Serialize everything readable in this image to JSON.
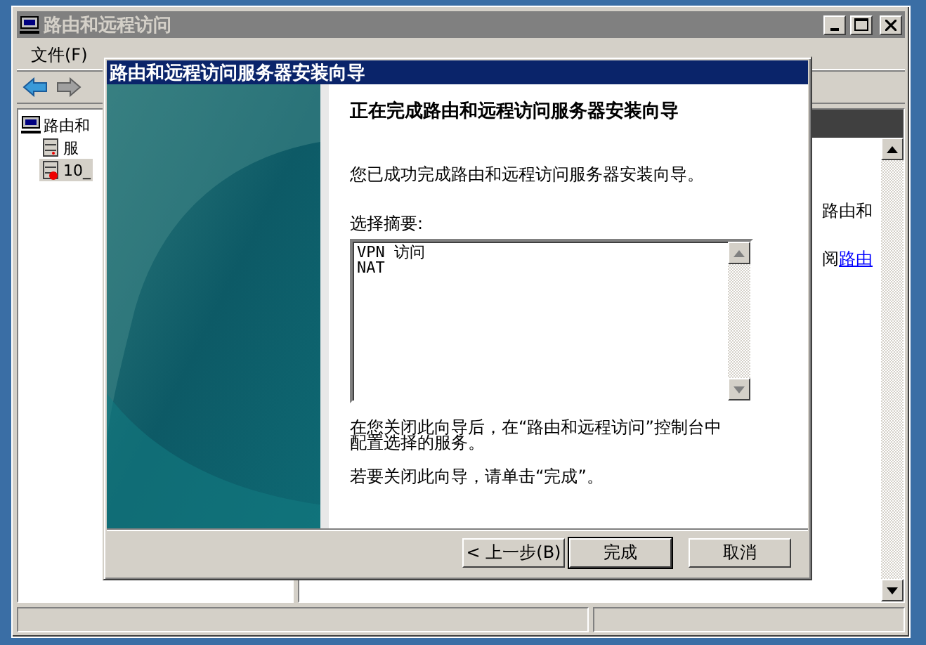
{
  "window": {
    "title": "路由和远程访问"
  },
  "menu": [
    "文件(F)"
  ],
  "tree": [
    {
      "label": "路由和",
      "selected": false,
      "children": [
        {
          "label": "服",
          "selected": false
        },
        {
          "label": "10_",
          "selected": true
        }
      ]
    }
  ],
  "right_pane": {
    "lines": [
      {
        "text": "路由和"
      },
      {
        "text": "阅",
        "link": "路由"
      }
    ]
  },
  "dialog": {
    "title": "路由和远程访问服务器安装向导",
    "heading": "正在完成路由和远程访问服务器安装向导",
    "intro": "您已成功完成路由和远程访问服务器安装向导。",
    "summary_label": "选择摘要:",
    "summary_lines": [
      "VPN 访问",
      "NAT"
    ],
    "note_lines": [
      "在您关闭此向导后，在“路由和远程访问”控制台中",
      "配置选择的服务。"
    ],
    "close_hint": "若要关闭此向导，请单击“完成”。",
    "buttons": [
      {
        "label": "< 上一步(B)",
        "default": false
      },
      {
        "label": "完成",
        "default": true
      },
      {
        "label": "取消",
        "default": false
      }
    ]
  }
}
